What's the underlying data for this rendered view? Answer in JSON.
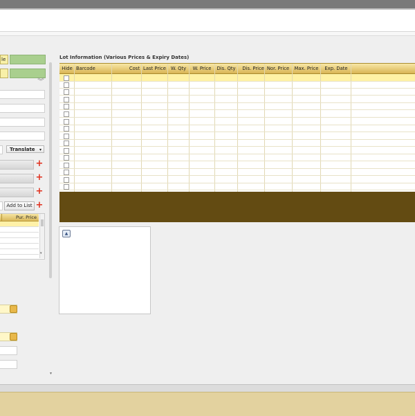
{
  "left": {
    "top_button_fragment": "le",
    "translate_label": "Translate",
    "add_to_list_label": "Add to List",
    "mini_table_header": "Pur. Price"
  },
  "lot": {
    "title": "Lot Information (Various Prices & Expiry Dates)",
    "columns": [
      "Hide",
      "Barcode",
      "Cost",
      "Last Price",
      "W. Qty",
      "W. Price",
      "Dis. Qty",
      "Dis. Price",
      "Nor. Price",
      "Max. Price",
      "Exp. Date"
    ]
  },
  "colors": {
    "header_gold": "#d9b555",
    "selected_row": "#fff2a5",
    "brown_panel": "#634b12",
    "footer_bar": "#e3d29f",
    "green_button": "#a9cf8e",
    "yellow_button": "#f8f0a8",
    "add_icon": "#e0301e"
  }
}
